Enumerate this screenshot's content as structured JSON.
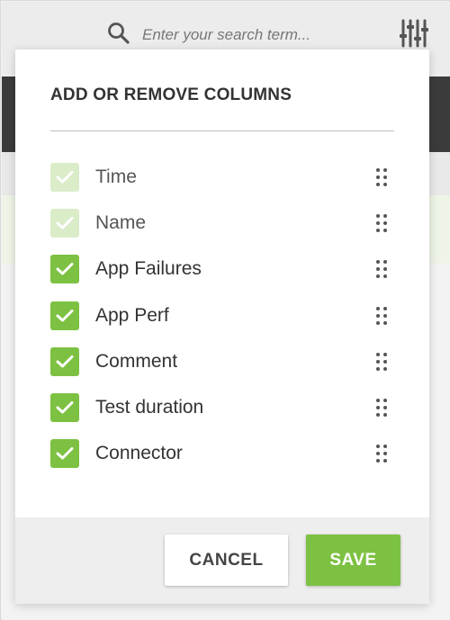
{
  "search": {
    "placeholder": "Enter your search term...",
    "icon": "search-icon"
  },
  "toolbar": {
    "filter_icon": "sliders-icon"
  },
  "dialog": {
    "title": "ADD OR REMOVE COLUMNS",
    "columns": [
      {
        "label": "Time",
        "checked": true,
        "locked": true
      },
      {
        "label": "Name",
        "checked": true,
        "locked": true
      },
      {
        "label": "App Failures",
        "checked": true,
        "locked": false
      },
      {
        "label": "App Perf",
        "checked": true,
        "locked": false
      },
      {
        "label": "Comment",
        "checked": true,
        "locked": false
      },
      {
        "label": "Test duration",
        "checked": true,
        "locked": false
      },
      {
        "label": "Connector",
        "checked": true,
        "locked": false
      }
    ],
    "cancel_label": "CANCEL",
    "save_label": "SAVE"
  },
  "colors": {
    "accent": "#7dc142",
    "accent_disabled": "#dbecc9",
    "header_dark": "#3b3b3b"
  }
}
